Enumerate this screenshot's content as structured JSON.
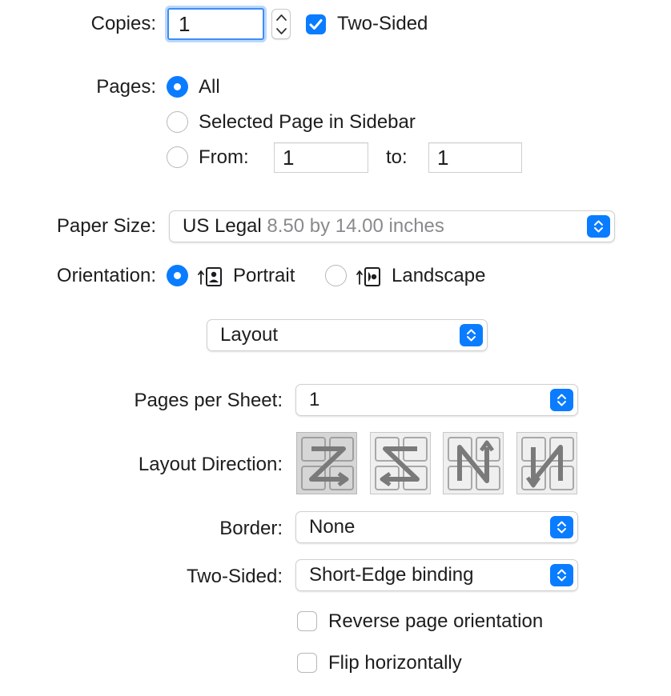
{
  "copies": {
    "label": "Copies:",
    "value": "1",
    "two_sided_label": "Two-Sided",
    "two_sided_checked": true
  },
  "pages": {
    "label": "Pages:",
    "options": {
      "all": "All",
      "selected": "Selected Page in Sidebar",
      "from": "From:"
    },
    "selected_option": "all",
    "from_value": "1",
    "to_label": "to:",
    "to_value": "1"
  },
  "paper_size": {
    "label": "Paper Size:",
    "value": "US Legal",
    "detail": "8.50 by 14.00 inches"
  },
  "orientation": {
    "label": "Orientation:",
    "portrait": "Portrait",
    "landscape": "Landscape",
    "selected": "portrait"
  },
  "section_popup": {
    "value": "Layout"
  },
  "layout": {
    "pages_per_sheet_label": "Pages per Sheet:",
    "pages_per_sheet_value": "1",
    "layout_direction_label": "Layout Direction:",
    "layout_directions": [
      "z-left-to-right",
      "z-right-to-left",
      "n-top-to-bottom-left",
      "n-top-to-bottom-right"
    ],
    "selected_direction": 0,
    "border_label": "Border:",
    "border_value": "None",
    "two_sided_label": "Two-Sided:",
    "two_sided_value": "Short-Edge binding",
    "reverse_label": "Reverse page orientation",
    "reverse_checked": false,
    "flip_label": "Flip horizontally",
    "flip_checked": false
  },
  "colors": {
    "accent": "#0a7cff",
    "focus_ring": "#3d8ef5",
    "secondary_text": "#8a8a8e"
  }
}
